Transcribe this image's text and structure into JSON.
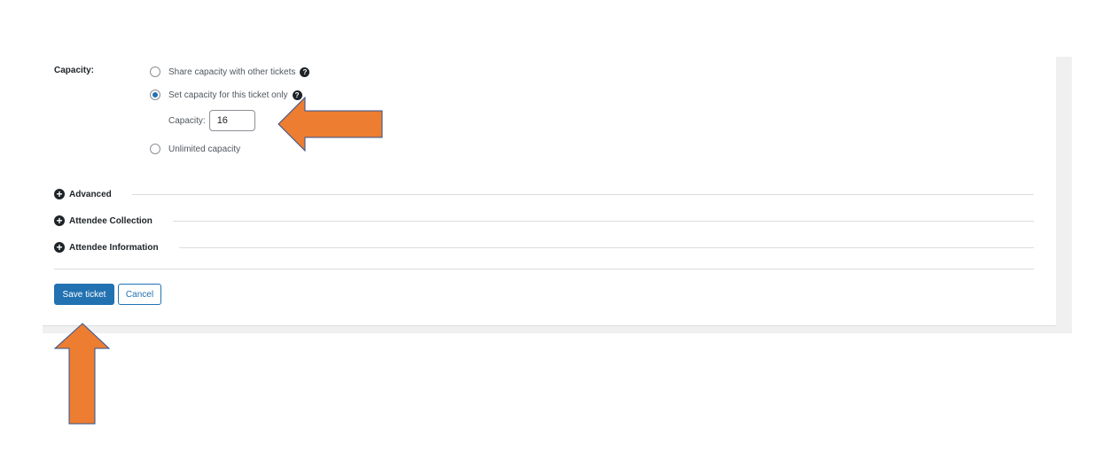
{
  "capacity_section": {
    "label": "Capacity:",
    "options": [
      {
        "label": "Share capacity with other tickets",
        "checked": false,
        "help": true
      },
      {
        "label": "Set capacity for this ticket only",
        "checked": true,
        "help": true
      },
      {
        "label": "Unlimited capacity",
        "checked": false,
        "help": false
      }
    ],
    "capacity_field_label": "Capacity:",
    "capacity_value": "16"
  },
  "collapsible_sections": [
    {
      "label": "Advanced"
    },
    {
      "label": "Attendee Collection"
    },
    {
      "label": "Attendee Information"
    }
  ],
  "actions": {
    "save_label": "Save ticket",
    "cancel_label": "Cancel"
  },
  "icons": {
    "help": "question-circle-icon",
    "expand": "plus-circle-icon"
  },
  "colors": {
    "primary": "#2271b1",
    "annotation_arrow_fill": "#ed7d31",
    "annotation_arrow_stroke": "#2f528f"
  }
}
